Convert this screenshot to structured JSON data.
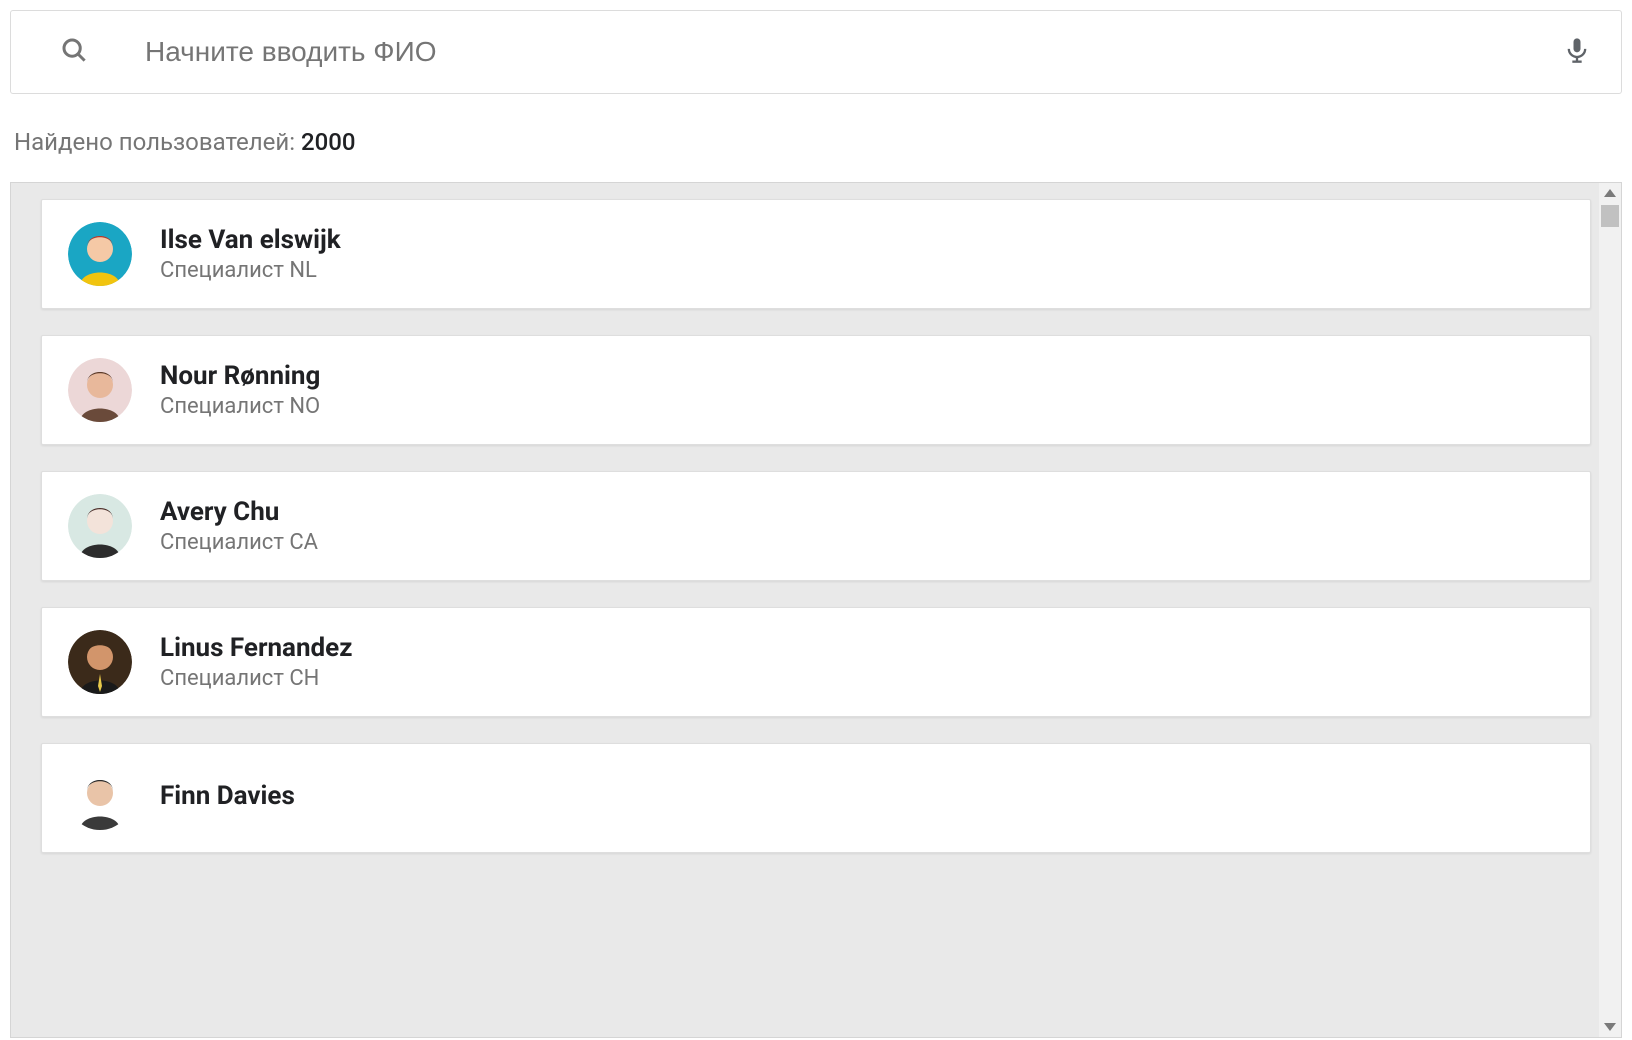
{
  "search": {
    "placeholder": "Начните вводить ФИО",
    "value": ""
  },
  "results": {
    "label": "Найдено пользователей: ",
    "count": "2000"
  },
  "users": [
    {
      "name": "Ilse Van elswijk",
      "role": "Специалист NL",
      "avatar": {
        "bg": "#1aa6c4",
        "hair": "#b03a2e",
        "skin": "#f5c9a6",
        "shirt": "#f1c40f"
      }
    },
    {
      "name": "Nour Rønning",
      "role": "Специалист NO",
      "avatar": {
        "bg": "#ecd7d7",
        "hair": "#5b3a29",
        "skin": "#e8b89b",
        "shirt": "#6a4a3a"
      }
    },
    {
      "name": "Avery Chu",
      "role": "Специалист CA",
      "avatar": {
        "bg": "#d8e8e3",
        "hair": "#4b2e2a",
        "skin": "#f3e3da",
        "shirt": "#2c2c2c"
      }
    },
    {
      "name": "Linus Fernandez",
      "role": "Специалист CH",
      "avatar": {
        "bg": "#3b2a1a",
        "hair": "#3a2a1a",
        "skin": "#d2956b",
        "shirt": "#1a1a1a",
        "tie": "#e6c84a"
      }
    },
    {
      "name": "Finn Davies",
      "role": "",
      "avatar": {
        "bg": "#ffffff",
        "hair": "#2b2b2b",
        "skin": "#e9c4a8",
        "shirt": "#3a3a3a"
      }
    }
  ]
}
